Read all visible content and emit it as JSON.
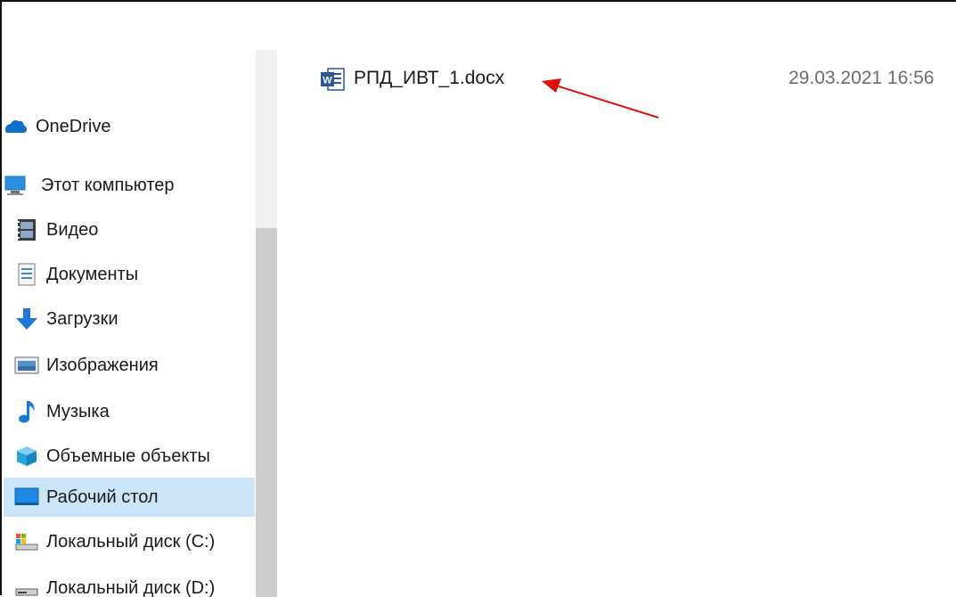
{
  "files": [
    {
      "name": "РПД_ИВТ_1.docx",
      "modified": "29.03.2021 16:56",
      "icon": "word-document-icon"
    }
  ],
  "sidebar": {
    "items": [
      {
        "label": "OneDrive",
        "icon": "onedrive-cloud-icon"
      },
      {
        "label": "Этот компьютер",
        "icon": "this-pc-icon"
      },
      {
        "label": "Видео",
        "icon": "video-folder-icon"
      },
      {
        "label": "Документы",
        "icon": "documents-folder-icon"
      },
      {
        "label": "Загрузки",
        "icon": "downloads-arrow-icon"
      },
      {
        "label": "Изображения",
        "icon": "pictures-folder-icon"
      },
      {
        "label": "Музыка",
        "icon": "music-note-icon"
      },
      {
        "label": "Объемные объекты",
        "icon": "3d-objects-icon"
      },
      {
        "label": "Рабочий стол",
        "icon": "desktop-icon",
        "selected": true
      },
      {
        "label": "Локальный диск (C:)",
        "icon": "local-disk-c-icon"
      },
      {
        "label": "Локальный диск (D:)",
        "icon": "local-disk-d-icon"
      }
    ]
  },
  "colors": {
    "selection": "#cce4f7",
    "annotation_arrow": "#e01010"
  }
}
